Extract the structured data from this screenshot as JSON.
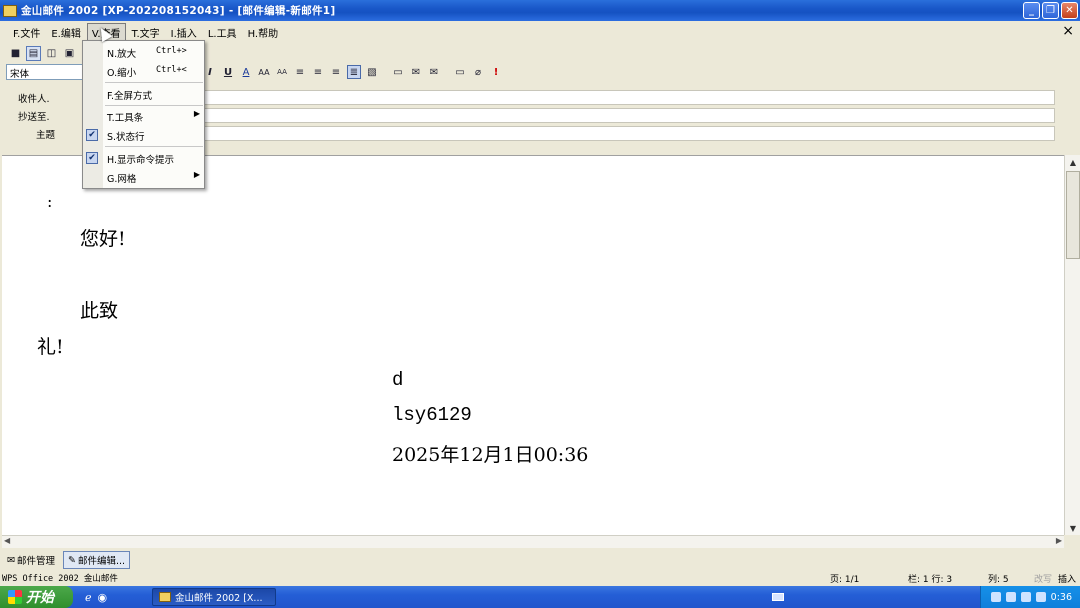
{
  "window": {
    "title": "金山邮件 2002 [XP-202208152043] - [邮件编辑-新邮件1]",
    "controls": [
      "minimize",
      "restore",
      "close"
    ]
  },
  "menubar": {
    "items": [
      {
        "key": "F",
        "label": "F.文件"
      },
      {
        "key": "E",
        "label": "E.编辑"
      },
      {
        "key": "V",
        "label": "V.查看"
      },
      {
        "key": "T",
        "label": "T.文字"
      },
      {
        "key": "I",
        "label": "I.插入"
      },
      {
        "key": "L",
        "label": "L.工具"
      },
      {
        "key": "H",
        "label": "H.帮助"
      }
    ],
    "close_glyph": "×"
  },
  "view_menu": {
    "items": [
      {
        "label": "N.放大",
        "shortcut": "Ctrl+>",
        "checked": false,
        "submenu": false
      },
      {
        "label": "O.缩小",
        "shortcut": "Ctrl+<",
        "checked": false,
        "submenu": false
      },
      {
        "label": "F.全屏方式",
        "shortcut": "",
        "checked": false,
        "submenu": false
      },
      {
        "label": "T.工具条",
        "shortcut": "",
        "checked": false,
        "submenu": true
      },
      {
        "label": "S.状态行",
        "shortcut": "",
        "checked": true,
        "submenu": false
      },
      {
        "label": "H.显示命令提示",
        "shortcut": "",
        "checked": true,
        "submenu": false
      },
      {
        "label": "G.网格",
        "shortcut": "",
        "checked": false,
        "submenu": true
      }
    ]
  },
  "toolbar": {
    "font_name": "宋体"
  },
  "header": {
    "to_label": "收件人.",
    "cc_label": "抄送至.",
    "subject_label": "主题",
    "to_value": "",
    "cc_value": "",
    "subject_value": ""
  },
  "body": {
    "colon": ":",
    "greeting": "您好!",
    "closing1": "此致",
    "closing2": "礼!",
    "sig_name": "d",
    "sig_user": "lsy6129",
    "sig_date": "2025年12月1日00:36"
  },
  "tabs": {
    "mail_manager": "邮件管理",
    "mail_editor": "邮件编辑..."
  },
  "statusbar": {
    "app": "WPS Office 2002 金山邮件",
    "page": "页: 1/1",
    "column_row": "栏: 1  行: 3",
    "col": "列: 5",
    "mode_rewrite": "改写",
    "mode_insert": "插入"
  },
  "taskbar": {
    "start": "开始",
    "task": "金山邮件 2002 [X...",
    "clock": "0:36"
  }
}
